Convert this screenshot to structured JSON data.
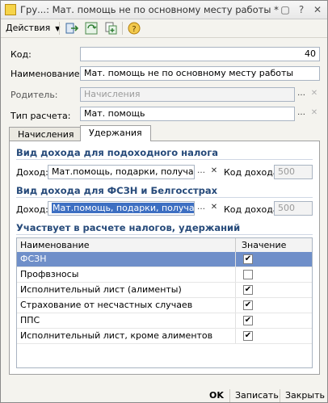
{
  "window": {
    "title": "Гру...: Мат. помощь не по основному месту работы *"
  },
  "toolbar": {
    "actions_label": "Действия"
  },
  "form": {
    "code_label": "Код:",
    "code_value": "40",
    "name_label": "Наименование:",
    "name_value": "Мат. помощь не по основному месту работы",
    "parent_label": "Родитель:",
    "parent_value": "Начисления",
    "type_label": "Тип расчета:",
    "type_value": "Мат. помощь"
  },
  "tabs": [
    {
      "label": "Начисления"
    },
    {
      "label": "Удержания"
    }
  ],
  "income_tax": {
    "section_title": "Вид дохода для подоходного налога",
    "income_label": "Доход:",
    "income_value": "Мат.помощь, подарки, получаемые",
    "code_label": "Код дохода:",
    "code_value": "500"
  },
  "fszn": {
    "section_title": "Вид дохода для ФСЗН и Белгосстрах",
    "income_label": "Доход:",
    "income_value": "Мат.помощь, подарки, получаемые",
    "code_label": "Код дохода:",
    "code_value": "500"
  },
  "taxes": {
    "section_title": "Участвует в расчете налогов, удержаний",
    "columns": [
      "Наименование",
      "Значение"
    ],
    "rows": [
      {
        "name": "ФСЗН",
        "checked": true,
        "selected": true
      },
      {
        "name": "Профвзносы",
        "checked": false,
        "selected": false
      },
      {
        "name": "Исполнительный лист (алименты)",
        "checked": true,
        "selected": false
      },
      {
        "name": "Страхование от несчастных случаев",
        "checked": true,
        "selected": false
      },
      {
        "name": "ППС",
        "checked": true,
        "selected": false
      },
      {
        "name": "Исполнительный лист, кроме алиментов",
        "checked": true,
        "selected": false
      }
    ]
  },
  "buttons": {
    "ok": "OK",
    "save": "Записать",
    "close": "Закрыть"
  },
  "colors": {
    "selection": "#6f8fc9",
    "section_title": "#264a7a"
  }
}
